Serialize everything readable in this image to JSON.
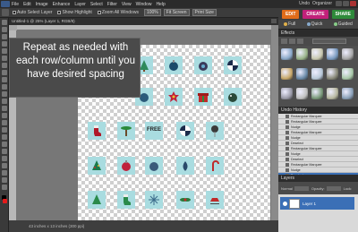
{
  "menubar": {
    "items": [
      "File",
      "Edit",
      "Image",
      "Enhance",
      "Layer",
      "Select",
      "Filter",
      "View",
      "Window",
      "Help"
    ],
    "undo_label": "Undo",
    "organizer_label": "Organizer"
  },
  "options": {
    "auto_select_layer": "Auto Select Layer",
    "show_highlight": "Show Highlight",
    "zoom_all": "Zoom All Windows",
    "pct_100": "100%",
    "fit_screen": "Fit Screen",
    "print_size": "Print Size"
  },
  "mode_tabs": {
    "edit": "EDIT",
    "create": "CREATE",
    "share": "SHARE"
  },
  "panel_tabs": {
    "full": "Full",
    "quick": "Quick",
    "guided": "Guided"
  },
  "document": {
    "title": "Untitled-1 @ 25% (Layer 1, RGB/8)",
    "status": "43 inches x 13 inches (300 ppi)"
  },
  "callout": {
    "text": "Repeat as needed with each row/column until you have desired spacing"
  },
  "tiles": {
    "free_label": "FREE"
  },
  "effects": {
    "title": "Effects",
    "colors": [
      "#8aa8c8",
      "#9ab48a",
      "#c8c8b0",
      "#7a9ac0",
      "#a8a8a8",
      "#c8a86a",
      "#6a8aa8",
      "#b8c8d8",
      "#8a8a7a",
      "#a8c8a8",
      "#9a9aa8",
      "#c0c0c0",
      "#7a9a7a",
      "#b8b8a0",
      "#8aa0b8"
    ]
  },
  "history": {
    "title": "Undo History",
    "rows": [
      "Rectangular Marquee",
      "Rectangular Marquee",
      "Nudge",
      "Rectangular Marquee",
      "Nudge",
      "Deselect",
      "Rectangular Marquee",
      "Nudge",
      "Deselect",
      "Rectangular Marquee",
      "Nudge",
      "Deselect"
    ]
  },
  "layers": {
    "title": "Layers",
    "mode_label": "Normal",
    "opacity_label": "Opacity:",
    "lock_label": "Lock:",
    "layer_name": "Layer 1"
  }
}
